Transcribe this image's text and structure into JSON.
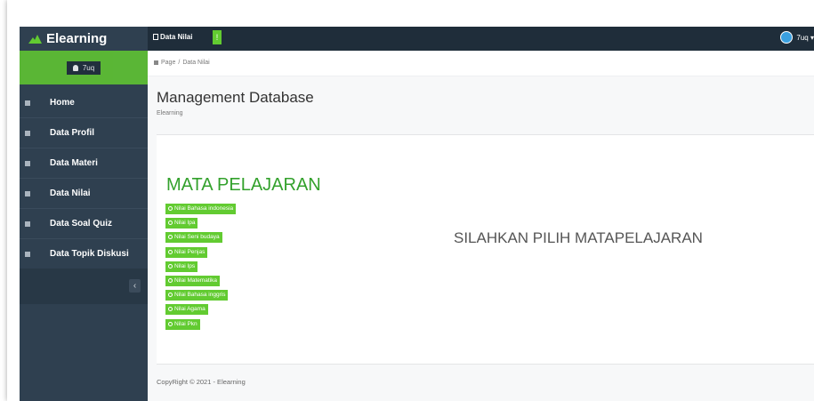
{
  "brand": {
    "title": "Elearning",
    "accent": "#62cb31"
  },
  "user": {
    "name": "7uq"
  },
  "sidebar": {
    "items": [
      {
        "label": "Home",
        "icon": "home-icon"
      },
      {
        "label": "Data Profil",
        "icon": "user-icon"
      },
      {
        "label": "Data Materi",
        "icon": "book-icon"
      },
      {
        "label": "Data Nilai",
        "icon": "book-icon"
      },
      {
        "label": "Data Soal Quiz",
        "icon": "edit-icon"
      },
      {
        "label": "Data Topik Diskusi",
        "icon": "calendar-icon"
      }
    ],
    "collapse_label": "‹"
  },
  "topbar": {
    "tab_label": "Data Nilai",
    "badge": "!",
    "user_label": "7uq ▾"
  },
  "breadcrumb": {
    "home": "Page",
    "sep": "/",
    "current": "Data Nilai"
  },
  "header": {
    "title": "Management Database",
    "subtitle": "Elearning"
  },
  "main": {
    "section_title": "MATA PELAJARAN",
    "subjects": [
      "Nilai Bahasa indonesia",
      "Nilai Ipa",
      "Nilai Seni budaya",
      "Nilai Penjas",
      "Nilai Ips",
      "Nilai Matematika",
      "Nilai Bahasa inggris",
      "Nilai Agama",
      "Nilai Pkn"
    ],
    "prompt": "SILAHKAN PILIH MATAPELAJARAN"
  },
  "footer": {
    "text": "CopyRight © 2021 - Elearning"
  }
}
